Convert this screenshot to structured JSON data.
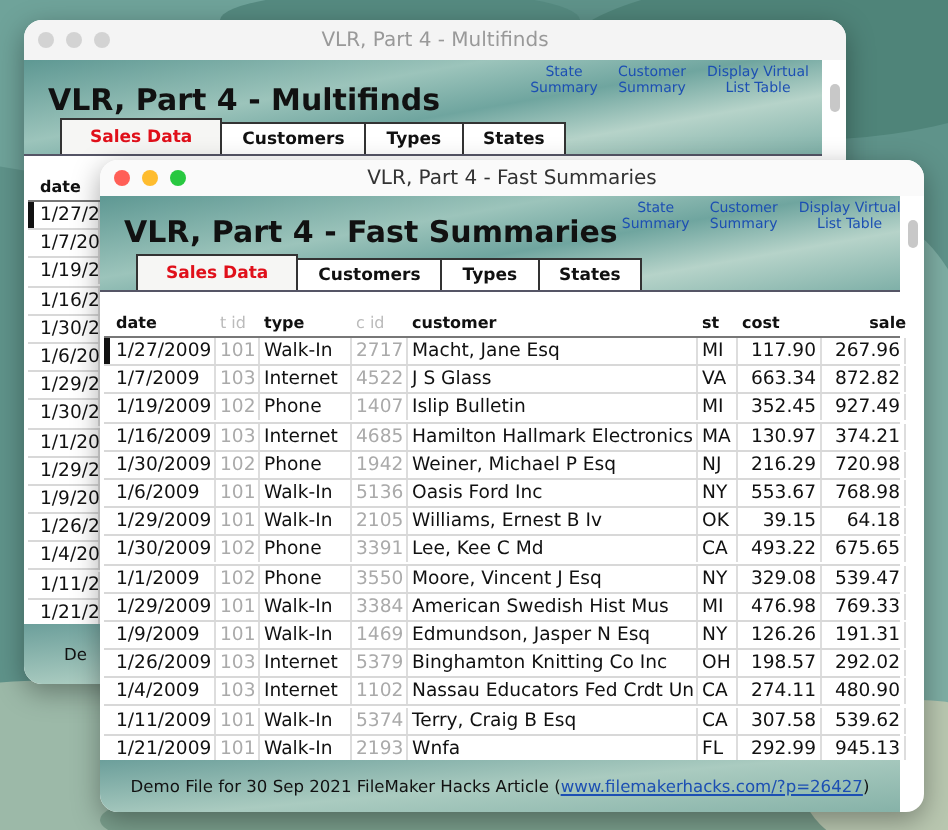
{
  "windows": [
    {
      "title": "VLR, Part 4 - Multifinds",
      "active": false,
      "heading": "VLR, Part 4 - Multifinds",
      "links": [
        "State Summary",
        "Customer Summary",
        "Display Virtual List Table"
      ],
      "tabs": [
        {
          "label": "Sales Data",
          "selected": true
        },
        {
          "label": "Customers",
          "selected": false
        },
        {
          "label": "Types",
          "selected": false
        },
        {
          "label": "States",
          "selected": false
        }
      ],
      "columns": [
        {
          "label": "date",
          "muted": false
        }
      ],
      "rows": [
        {
          "cells": [
            "1/27/2"
          ],
          "selected": true
        },
        {
          "cells": [
            "1/7/20"
          ],
          "selected": false
        },
        {
          "cells": [
            "1/19/2"
          ],
          "selected": false
        },
        {
          "cells": [
            "1/16/2"
          ],
          "selected": false
        },
        {
          "cells": [
            "1/30/2"
          ],
          "selected": false
        },
        {
          "cells": [
            "1/6/20"
          ],
          "selected": false
        },
        {
          "cells": [
            "1/29/2"
          ],
          "selected": false
        },
        {
          "cells": [
            "1/30/2"
          ],
          "selected": false
        },
        {
          "cells": [
            "1/1/20"
          ],
          "selected": false
        },
        {
          "cells": [
            "1/29/2"
          ],
          "selected": false
        },
        {
          "cells": [
            "1/9/20"
          ],
          "selected": false
        },
        {
          "cells": [
            "1/26/2"
          ],
          "selected": false
        },
        {
          "cells": [
            "1/4/20"
          ],
          "selected": false
        },
        {
          "cells": [
            "1/11/2"
          ],
          "selected": false
        },
        {
          "cells": [
            "1/21/2"
          ],
          "selected": false
        }
      ],
      "footer": {
        "text": "De"
      }
    },
    {
      "title": "VLR, Part 4 - Fast Summaries",
      "active": true,
      "heading": "VLR, Part 4 - Fast Summaries",
      "links": [
        "State Summary",
        "Customer Summary",
        "Display Virtual List Table"
      ],
      "tabs": [
        {
          "label": "Sales Data",
          "selected": true
        },
        {
          "label": "Customers",
          "selected": false
        },
        {
          "label": "Types",
          "selected": false
        },
        {
          "label": "States",
          "selected": false
        }
      ],
      "columns": [
        {
          "label": "date",
          "muted": false
        },
        {
          "label": "t id",
          "muted": true
        },
        {
          "label": "type",
          "muted": false
        },
        {
          "label": "c id",
          "muted": true
        },
        {
          "label": "customer",
          "muted": false
        },
        {
          "label": "st",
          "muted": false
        },
        {
          "label": "cost",
          "muted": false
        },
        {
          "label": "sale",
          "muted": false
        }
      ],
      "rows": [
        {
          "cells": [
            "1/27/2009",
            "101",
            "Walk-In",
            "2717",
            "Macht, Jane Esq",
            "MI",
            "117.90",
            "267.96"
          ],
          "selected": true
        },
        {
          "cells": [
            "1/7/2009",
            "103",
            "Internet",
            "4522",
            "J S Glass",
            "VA",
            "663.34",
            "872.82"
          ],
          "selected": false
        },
        {
          "cells": [
            "1/19/2009",
            "102",
            "Phone",
            "1407",
            "Islip Bulletin",
            "MI",
            "352.45",
            "927.49"
          ],
          "selected": false
        },
        {
          "cells": [
            "1/16/2009",
            "103",
            "Internet",
            "4685",
            "Hamilton Hallmark Electronics",
            "MA",
            "130.97",
            "374.21"
          ],
          "selected": false
        },
        {
          "cells": [
            "1/30/2009",
            "102",
            "Phone",
            "1942",
            "Weiner, Michael P Esq",
            "NJ",
            "216.29",
            "720.98"
          ],
          "selected": false
        },
        {
          "cells": [
            "1/6/2009",
            "101",
            "Walk-In",
            "5136",
            "Oasis Ford Inc",
            "NY",
            "553.67",
            "768.98"
          ],
          "selected": false
        },
        {
          "cells": [
            "1/29/2009",
            "101",
            "Walk-In",
            "2105",
            "Williams, Ernest B Iv",
            "OK",
            "39.15",
            "64.18"
          ],
          "selected": false
        },
        {
          "cells": [
            "1/30/2009",
            "102",
            "Phone",
            "3391",
            "Lee, Kee C Md",
            "CA",
            "493.22",
            "675.65"
          ],
          "selected": false
        },
        {
          "cells": [
            "1/1/2009",
            "102",
            "Phone",
            "3550",
            "Moore, Vincent J Esq",
            "NY",
            "329.08",
            "539.47"
          ],
          "selected": false
        },
        {
          "cells": [
            "1/29/2009",
            "101",
            "Walk-In",
            "3384",
            "American Swedish Hist Mus",
            "MI",
            "476.98",
            "769.33"
          ],
          "selected": false
        },
        {
          "cells": [
            "1/9/2009",
            "101",
            "Walk-In",
            "1469",
            "Edmundson, Jasper N Esq",
            "NY",
            "126.26",
            "191.31"
          ],
          "selected": false
        },
        {
          "cells": [
            "1/26/2009",
            "103",
            "Internet",
            "5379",
            "Binghamton Knitting Co Inc",
            "OH",
            "198.57",
            "292.02"
          ],
          "selected": false
        },
        {
          "cells": [
            "1/4/2009",
            "103",
            "Internet",
            "1102",
            "Nassau Educators Fed Crdt Un",
            "CA",
            "274.11",
            "480.90"
          ],
          "selected": false
        },
        {
          "cells": [
            "1/11/2009",
            "101",
            "Walk-In",
            "5374",
            "Terry, Craig B Esq",
            "CA",
            "307.58",
            "539.62"
          ],
          "selected": false
        },
        {
          "cells": [
            "1/21/2009",
            "101",
            "Walk-In",
            "2193",
            "Wnfa",
            "FL",
            "292.99",
            "945.13"
          ],
          "selected": false
        }
      ],
      "footer": {
        "text": "Demo File for 30 Sep 2021 FileMaker Hacks Article (",
        "link": "www.filemakerhacks.com/?p=26427",
        "after": ")"
      }
    }
  ]
}
